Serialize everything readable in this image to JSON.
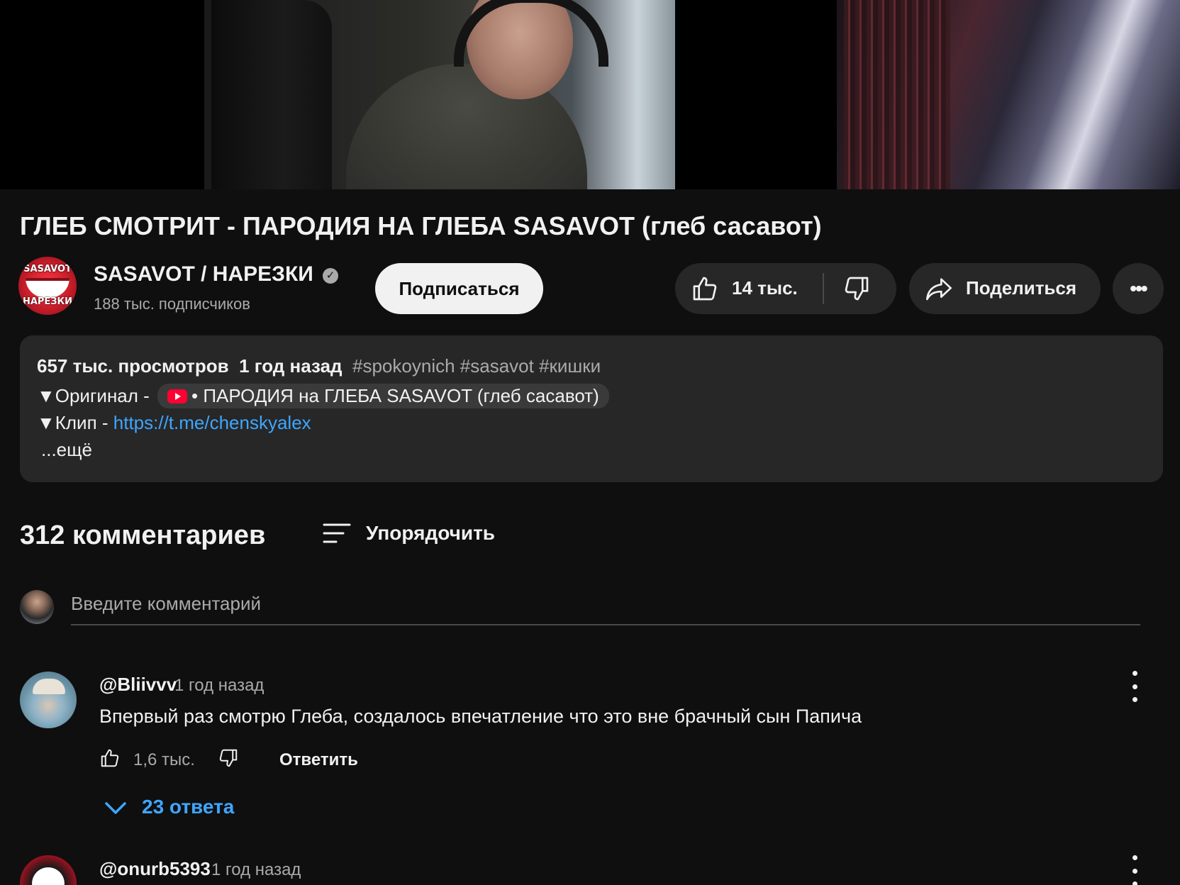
{
  "video": {
    "title": "ГЛЕБ СМОТРИТ - ПАРОДИЯ НА ГЛЕБА SASAVOT (глеб сасавот)"
  },
  "channel": {
    "name": "SASAVOT / НАРЕЗКИ",
    "subscribers": "188 тыс. подписчиков",
    "avatar_text_top": "SASAVOT",
    "avatar_text_bottom": "НАРЕЗКИ",
    "verified_icon": "verified-check-icon"
  },
  "actions": {
    "subscribe_label": "Подписаться",
    "like_count": "14 тыс.",
    "share_label": "Поделиться",
    "more_label": "•••"
  },
  "description": {
    "views": "657 тыс. просмотров",
    "date": "1 год назад",
    "tags": "#spokoynich #sasavot #кишки",
    "original_prefix": "▼Оригинал - ",
    "original_link": "• ПАРОДИЯ на ГЛЕБА SASAVOT (глеб сасавот)",
    "clip_prefix": "▼Клип - ",
    "clip_link": "https://t.me/chenskyalex",
    "more": "...ещё"
  },
  "comments": {
    "count_label": "312 комментариев",
    "sort_label": "Упорядочить",
    "input_placeholder": "Введите комментарий",
    "items": [
      {
        "author": "@Bliivvv",
        "time": "1 год назад",
        "text": "Впервый раз смотрю Глеба, создалось впечатление что это вне брачный сын Папича",
        "likes": "1,6 тыс.",
        "reply_label": "Ответить",
        "replies_label": "23 ответа"
      },
      {
        "author": "@onurb5393",
        "time": "1 год назад"
      }
    ]
  },
  "colors": {
    "background": "#0f0f0f",
    "surface": "#272727",
    "link": "#3ea6ff",
    "text": "#f1f1f1",
    "muted": "#aaaaaa"
  }
}
